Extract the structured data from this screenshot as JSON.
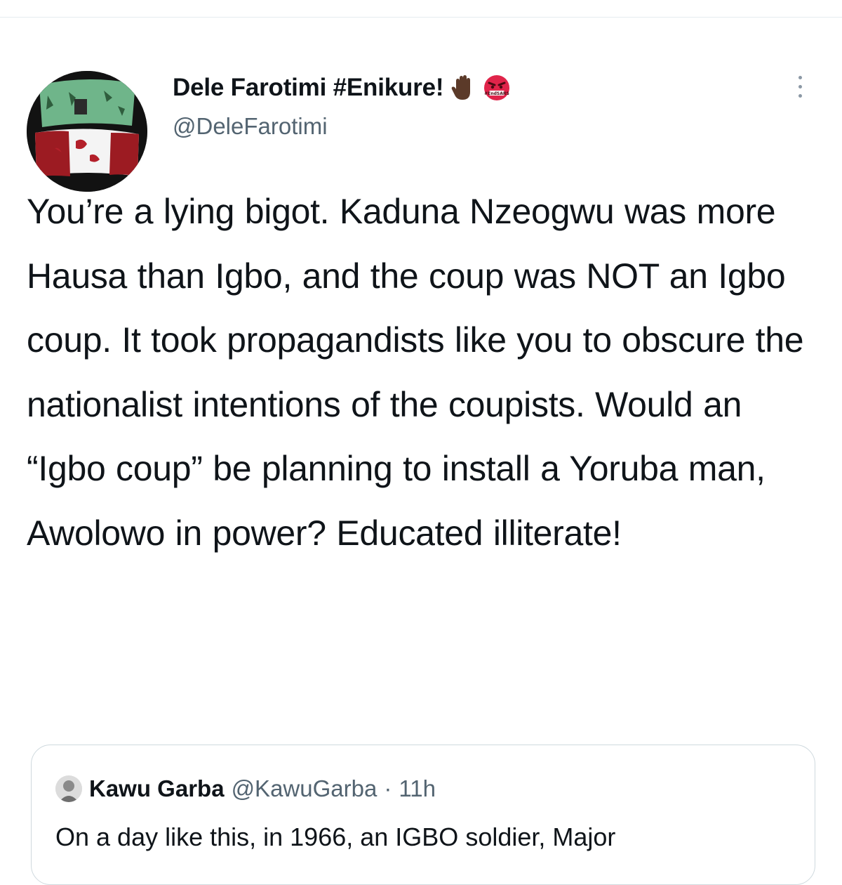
{
  "tweet": {
    "author_name": "Dele Farotimi #Enikure!",
    "author_handle": "@DeleFarotimi",
    "author_emojis": [
      "raised-hand-icon",
      "angry-face-icon"
    ],
    "emoji_badge_text": "#EndSARS",
    "text": "You’re a lying bigot. Kaduna Nzeogwu was more Hausa than Igbo, and the coup was NOT an Igbo coup. It took propagandists like you to obscure the nationalist intentions of the coupists. Would an “Igbo coup” be planning to install a Yoruba man, Awolowo in power? Educated illiterate!"
  },
  "quote": {
    "author_name": "Kawu Garba",
    "author_handle": "@KawuGarba",
    "separator": "·",
    "timestamp": "11h",
    "text_partial": "On a day like this, in 1966, an IGBO soldier, Major"
  },
  "colors": {
    "text_primary": "#0f1419",
    "text_secondary": "#536471",
    "border": "#cfd9de",
    "angry_face": "#e0244a"
  }
}
